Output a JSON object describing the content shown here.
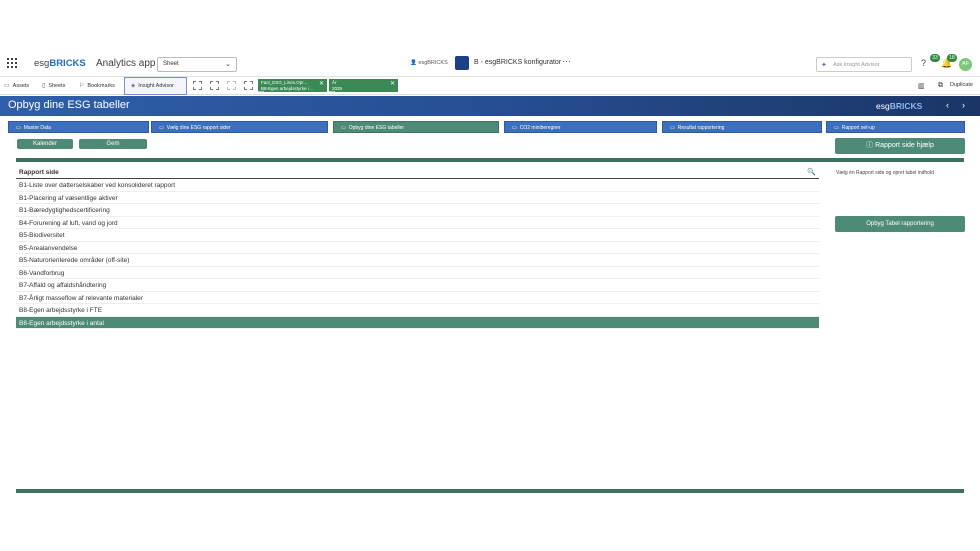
{
  "topbar": {
    "logo_prefix": "esg",
    "logo_brand": "BRICKS",
    "app_name": "Analytics app",
    "sheet_selector": "Sheet",
    "center_user": "esgBRICKS",
    "center_title": "B - esgBRICKS konfigurator",
    "more": "···",
    "ask_placeholder": "Ask Insight Advisor",
    "help_badge": "33",
    "notif_badge": "18",
    "avatar": "AF"
  },
  "toolbar": {
    "assets": "Assets",
    "sheets": "Sheets",
    "bookmarks": "Bookmarks",
    "insight": "Insight Advisor",
    "duplicate": "Duplicate",
    "chips": [
      {
        "label": "Fact_ESG_Lines.Opr...",
        "value": "B8-Egen arbejdsstyrke i ..."
      },
      {
        "label": "År",
        "value": "2025"
      }
    ]
  },
  "banner": {
    "title": "Opbyg dine ESG tabeller",
    "logo_prefix": "esg",
    "logo_brand": "BRICKS",
    "prev": "‹",
    "next": "›"
  },
  "nav": [
    "Master Data",
    "Vælg dine ESG rapport sider",
    "Opbyg dine ESG tabeller",
    "CO2 miniberegner",
    "Resultat rapportering",
    "Rapport set-up"
  ],
  "buttons": {
    "kalender": "Kalender",
    "gem": "Gem",
    "help": "Rapport side hjælp",
    "opbyg": "Opbyg Tabel rapportering"
  },
  "side_note": "Vælg én Rapport side og opret tabel indhold",
  "table": {
    "header": "Rapport side",
    "rows": [
      "B1-Liste over datterselskaber ved konsolideret rapport",
      "B1-Placering af væsentlige aktiver",
      "B1-Bæredygtighedscertificering",
      "B4-Forurening af luft, vand og jord",
      "B5-Biodiversitet",
      "B5-Arealanvendelse",
      "B5-Naturorienterede områder (off-site)",
      "B6-Vandforbrug",
      "B7-Affald og affaldshåndtering",
      "B7-Årligt masseflow af relevante materialer",
      "B8-Egen arbejdsstyrke i FTE",
      "B8-Egen arbejdsstyrke i antal"
    ],
    "selected_index": 11
  },
  "colors": {
    "accent_green": "#4d8a77",
    "nav_blue": "#3c6fbd",
    "banner_blue": "#2f5faa"
  }
}
